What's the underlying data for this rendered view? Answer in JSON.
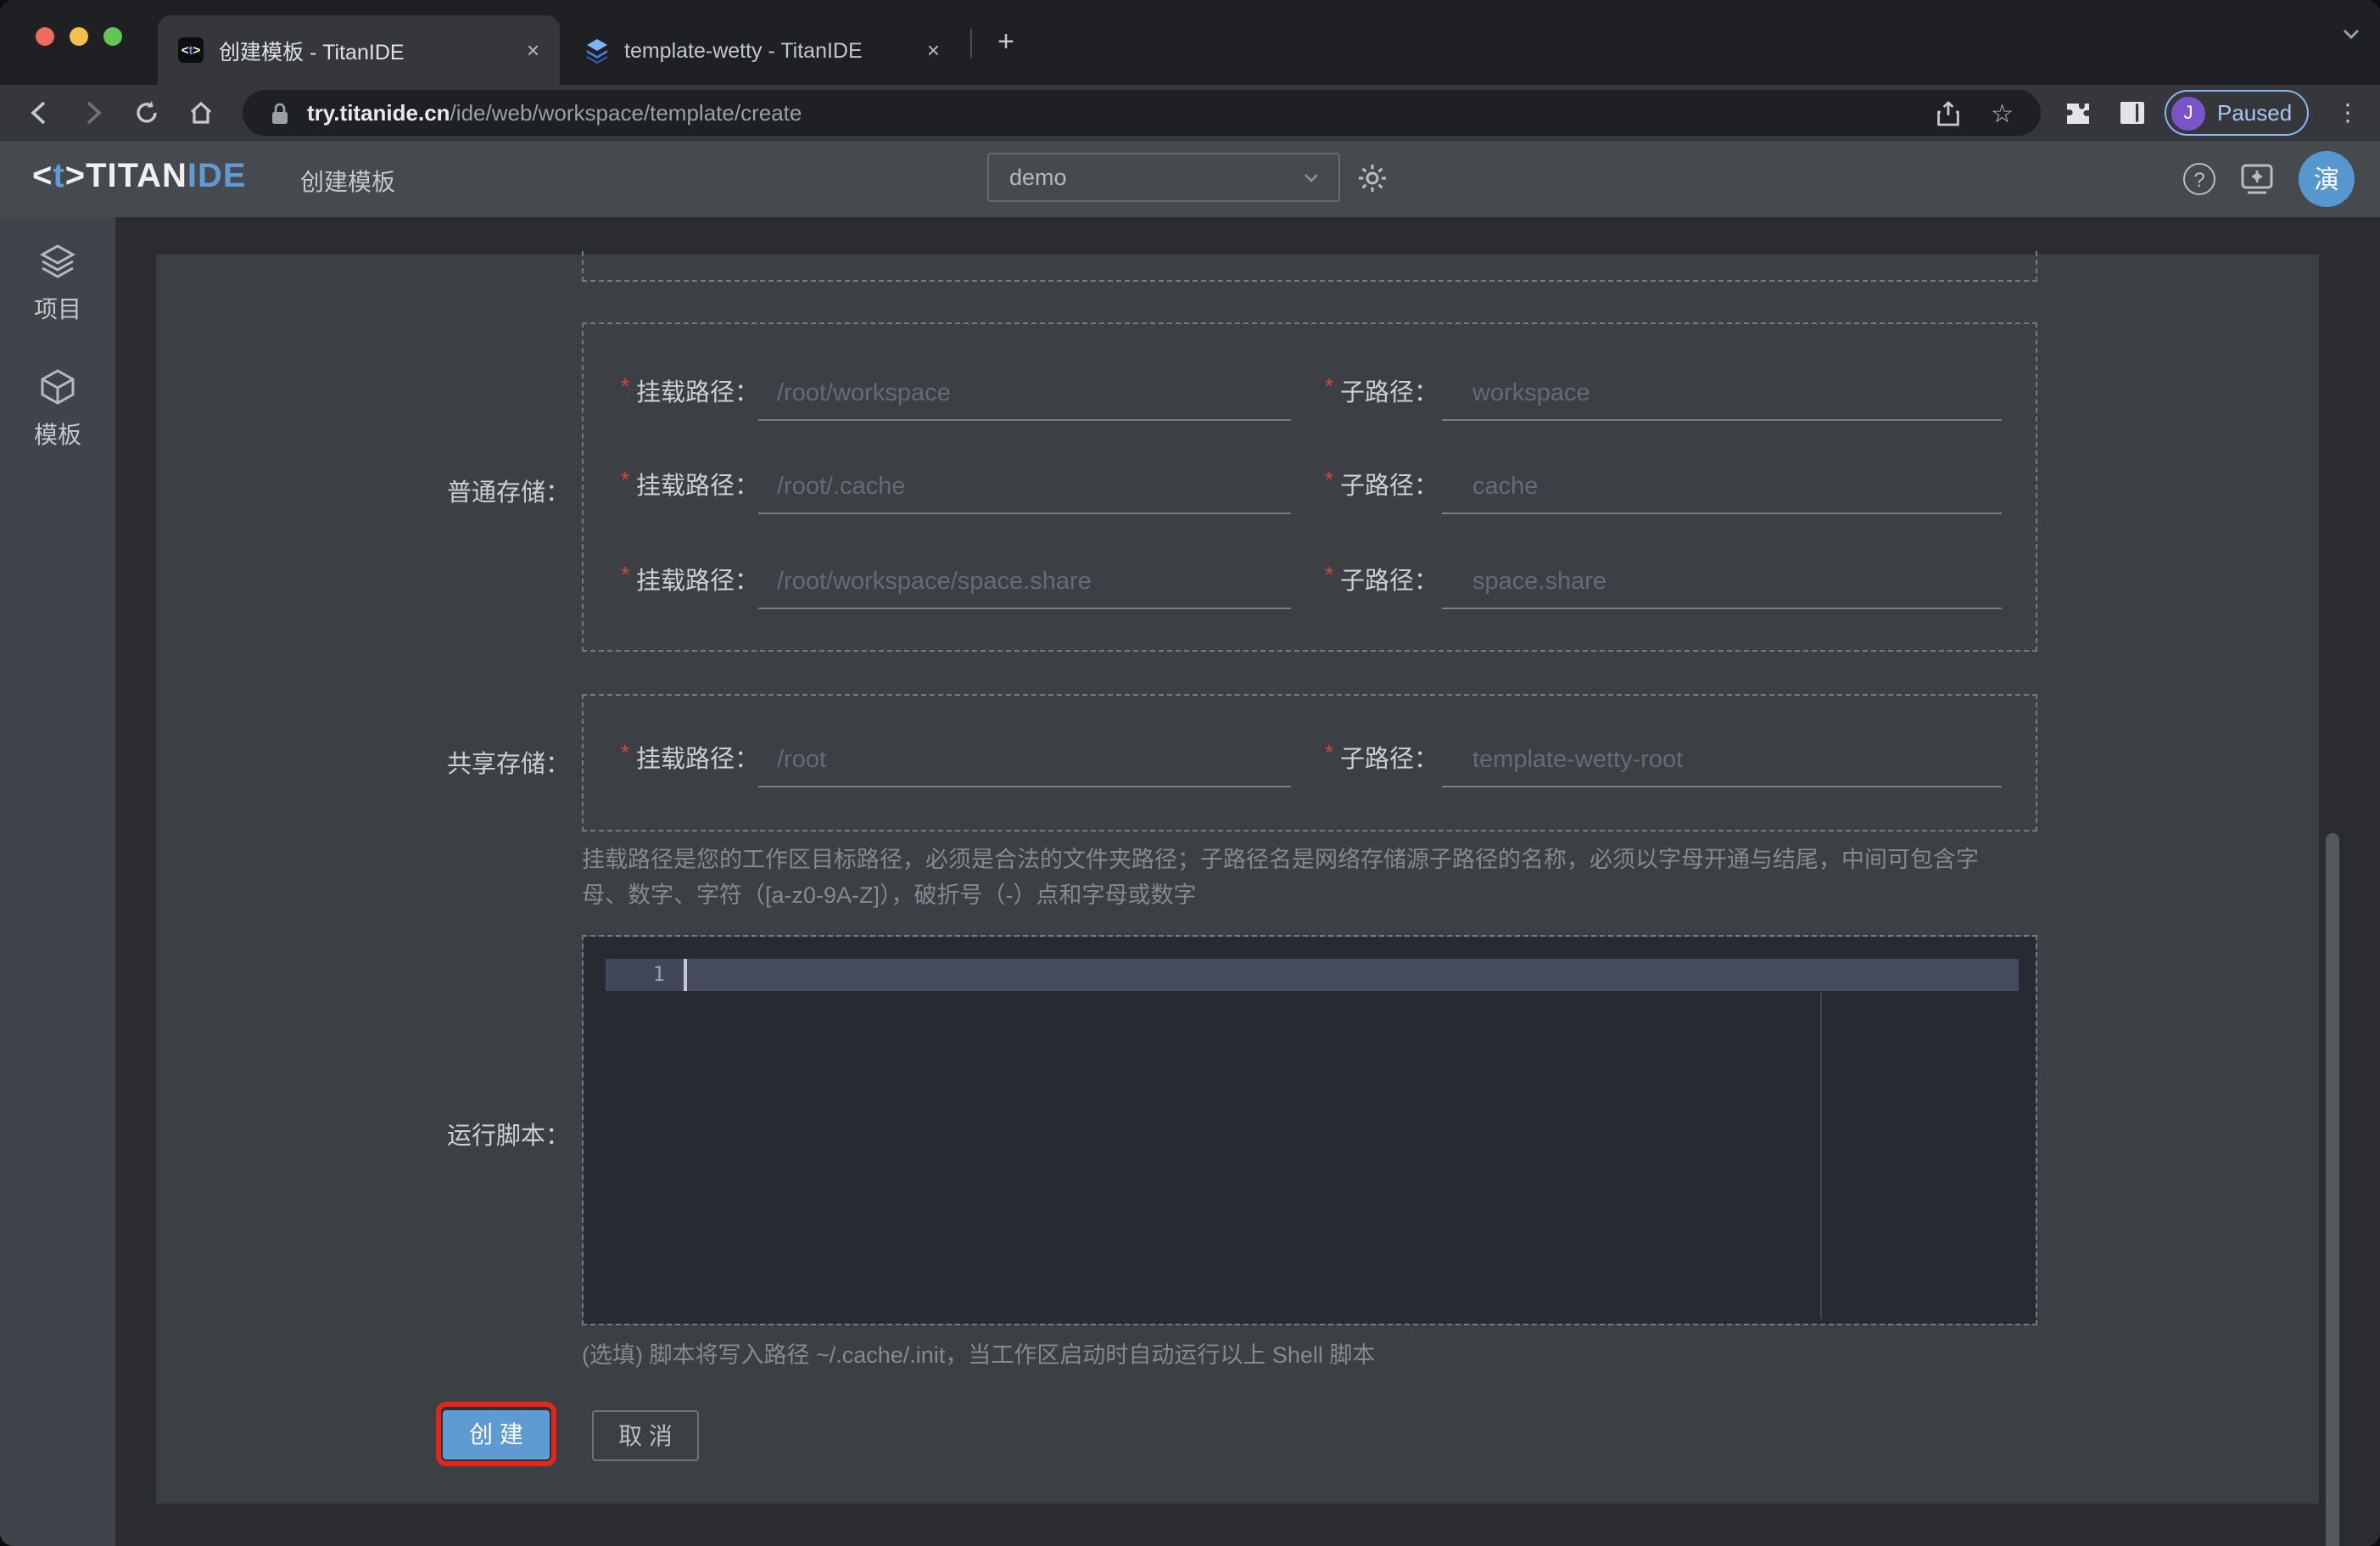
{
  "icons": {
    "close": "×",
    "new_tab": "+",
    "more": "⋮",
    "star": "☆",
    "help_mark": "?"
  },
  "colors": {
    "accent_blue": "#5f9ad2",
    "button_blue": "#5d9bd2",
    "annotation_red": "#e1261a",
    "avatar_blue": "#5697cf",
    "profile_purple": "#7a54c9",
    "paused_text": "#a9c6f0",
    "traffic_red": "#ee6a5f",
    "traffic_yellow": "#f5bf4f",
    "traffic_green": "#62c554"
  },
  "browser": {
    "tabs": [
      {
        "title": "创建模板 - TitanIDE"
      },
      {
        "title": "template-wetty - TitanIDE"
      }
    ],
    "address": {
      "host": "try.titanide.cn",
      "path": "/ide/web/workspace/template/create"
    },
    "profile": {
      "initial": "J",
      "status": "Paused"
    }
  },
  "app": {
    "logo": {
      "open": "<",
      "t": "t",
      "close": ">",
      "main": "TITAN",
      "accent": "IDE"
    },
    "page_title": "创建模板",
    "workspace_select": {
      "value": "demo"
    },
    "avatar": "演",
    "sidebar": [
      {
        "label": "项目"
      },
      {
        "label": "模板"
      }
    ]
  },
  "form": {
    "required_mark": "*",
    "mount_label": "挂载路径：",
    "sub_label": "子路径：",
    "normal": {
      "label": "普通存储：",
      "rows": [
        {
          "mount": "/root/workspace",
          "sub": "workspace"
        },
        {
          "mount": "/root/.cache",
          "sub": "cache"
        },
        {
          "mount": "/root/workspace/space.share",
          "sub": "space.share"
        }
      ]
    },
    "shared": {
      "label": "共享存储：",
      "rows": [
        {
          "mount": "/root",
          "sub": "template-wetty-root"
        }
      ]
    },
    "hint": {
      "line1": "挂载路径是您的工作区目标路径，必须是合法的文件夹路径；子路径名是网络存储源子路径的名称，必须以字母开通与结尾，中间可包含字",
      "line2": "母、数字、字符（[a-z0-9A-Z]），破折号（-）点和字母或数字"
    },
    "script": {
      "label": "运行脚本：",
      "line_number": "1"
    },
    "note": "(选填) 脚本将写入路径 ~/.cache/.init，当工作区启动时自动运行以上 Shell 脚本",
    "actions": {
      "create": "创 建",
      "cancel": "取 消"
    }
  }
}
